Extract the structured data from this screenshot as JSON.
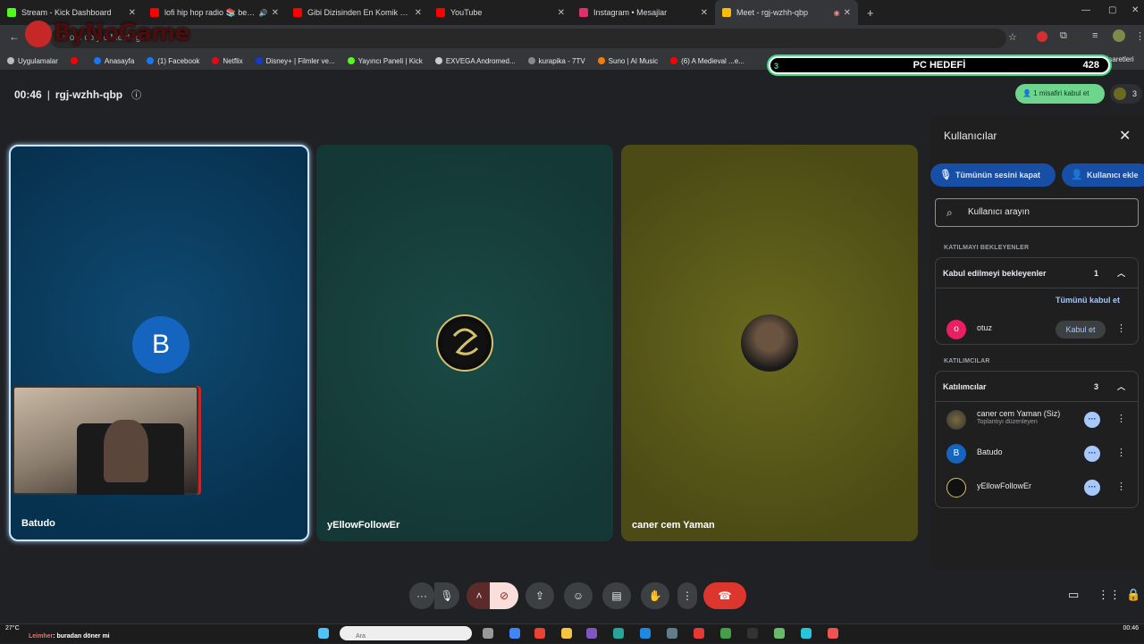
{
  "browser": {
    "tabs": [
      {
        "label": "Stream - Kick Dashboard",
        "color": "#53fc18",
        "active": false
      },
      {
        "label": "lofi hip hop radio 📚 beats",
        "color": "#ff0000",
        "active": false,
        "audio": "🔊"
      },
      {
        "label": "Gibi Dizisinden En Komik Sahne",
        "color": "#ff0000",
        "active": false
      },
      {
        "label": "YouTube",
        "color": "#ff0000",
        "active": false
      },
      {
        "label": "Instagram • Mesajlar",
        "color": "#e1306c",
        "active": false
      },
      {
        "label": "Meet - rgj-wzhh-qbp",
        "color": "#fbbc04",
        "active": true
      }
    ],
    "new_tab": "+",
    "url_fragment": "c  o   u   co   y  c   Meet  rg",
    "logo_text": "ByNoGame",
    "bookmarks": [
      {
        "label": "Uygulamalar",
        "color": "#bbbbbb"
      },
      {
        "label": "",
        "color": "#ff0000"
      },
      {
        "label": "Anasayfa",
        "color": "#1877f2"
      },
      {
        "label": "(1) Facebook",
        "color": "#1877f2"
      },
      {
        "label": "Netflix",
        "color": "#e50914"
      },
      {
        "label": "Disney+ | Filmler ve...",
        "color": "#113ccf"
      },
      {
        "label": "Yayıncı Paneli | Kick",
        "color": "#53fc18"
      },
      {
        "label": "EXVEGA Andromed...",
        "color": "#cccccc"
      },
      {
        "label": "kurapika - 7TV",
        "color": "#888888"
      },
      {
        "label": "Suno | AI Music",
        "color": "#f57c00"
      },
      {
        "label": "(6) A Medieval ...e...",
        "color": "#ff0000"
      }
    ],
    "bookmarks_right": "Tüm Yer İşaretleri"
  },
  "overlay": {
    "goal_title": "PC HEDEFİ",
    "goal_left": "3",
    "goal_value": "428"
  },
  "meet": {
    "time": "00:46",
    "separator": "|",
    "code": "rgj-wzhh-qbp",
    "admit_chip": "1 misafiri kabul et",
    "people_count": "3",
    "tiles": [
      {
        "name": "Batudo",
        "initial": "B"
      },
      {
        "name": "yEllowFollowEr"
      },
      {
        "name": "caner cem Yaman"
      }
    ],
    "panel": {
      "title": "Kullanıcılar",
      "mute_all": "Tümünün sesini kapat",
      "add_user": "Kullanıcı ekle",
      "search_placeholder": "Kullanıcı arayın",
      "waiting_section": "KATILMAYI BEKLEYENLER",
      "waiting_group": {
        "label": "Kabul edilmeyi bekleyenler",
        "count": "1"
      },
      "admit_all": "Tümünü kabul et",
      "waiting_person": {
        "initial": "o",
        "name": "otuz",
        "admit": "Kabul et",
        "color": "#e91e63"
      },
      "participants_section": "KATILIMCILAR",
      "participants_group": {
        "label": "Katılımcılar",
        "count": "3"
      },
      "participants": [
        {
          "name": "caner cem Yaman (Siz)",
          "sub": "Toplantıyı düzenleyen",
          "initial": "",
          "color": "#5a5a20"
        },
        {
          "name": "Batudo",
          "sub": "",
          "initial": "B",
          "color": "#1565c0"
        },
        {
          "name": "yEllowFollowEr",
          "sub": "",
          "initial": "",
          "color": "#222222"
        }
      ]
    }
  },
  "taskbar": {
    "weather": "27°C",
    "chat_user": "Leimher",
    "chat_text": ": buradan döner mi",
    "search_hint": "Ara",
    "clock": "00:46"
  }
}
